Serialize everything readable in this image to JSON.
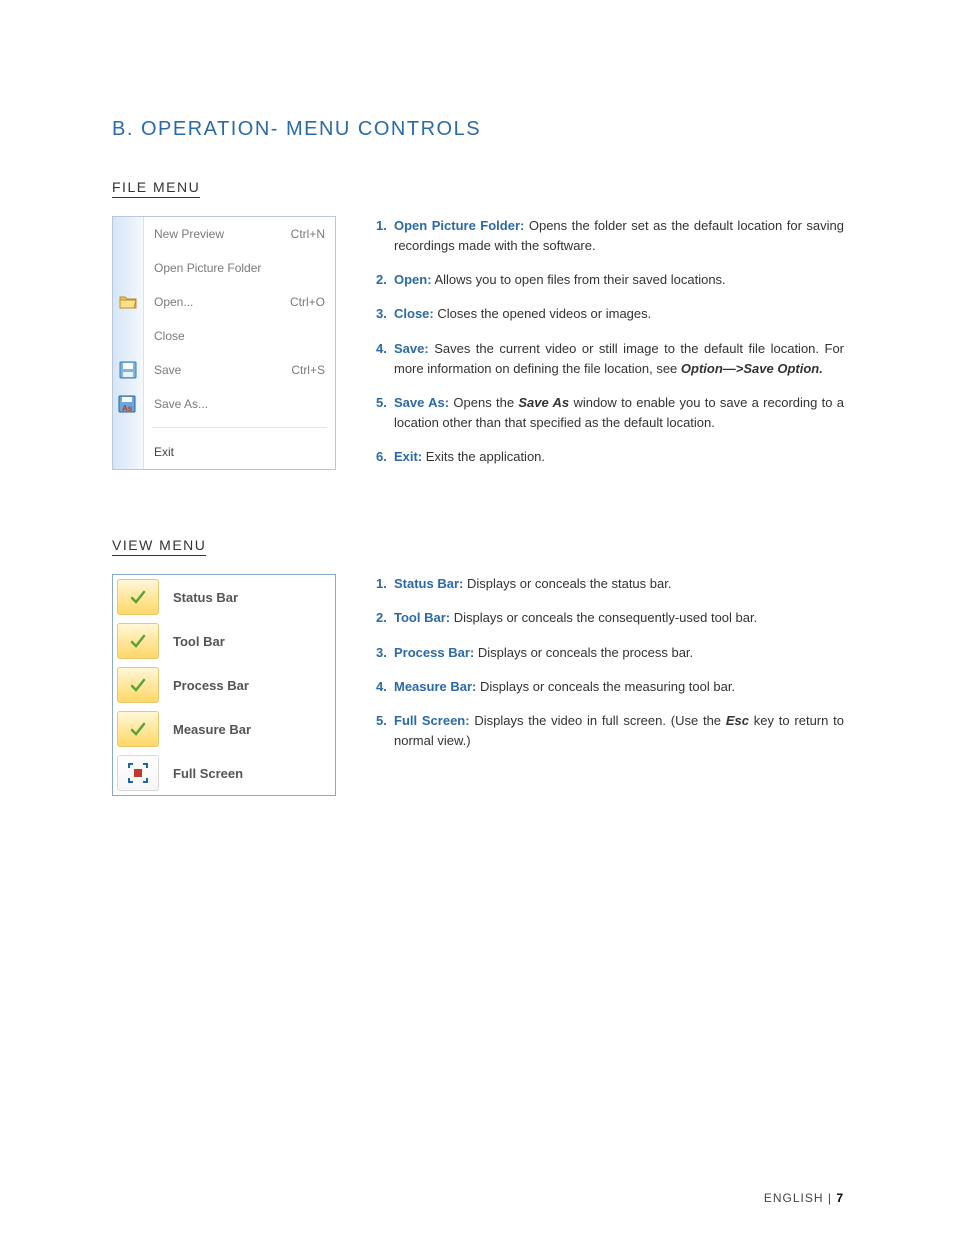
{
  "section_title": "B. OPERATION- MENU CONTROLS",
  "file_menu": {
    "heading": "FILE MENU",
    "items": [
      {
        "label": "New Preview",
        "shortcut": "Ctrl+N",
        "icon": ""
      },
      {
        "label": "Open Picture Folder",
        "shortcut": "",
        "icon": ""
      },
      {
        "label": "Open...",
        "shortcut": "Ctrl+O",
        "icon": "folder"
      },
      {
        "label": "Close",
        "shortcut": "",
        "icon": ""
      },
      {
        "label": "Save",
        "shortcut": "Ctrl+S",
        "icon": "disk"
      },
      {
        "label": "Save As...",
        "shortcut": "",
        "icon": "saveas"
      },
      {
        "sep": true
      },
      {
        "label": "Exit",
        "shortcut": "",
        "icon": ""
      }
    ],
    "descriptions": [
      {
        "n": "1.",
        "term": "Open Picture Folder:",
        "body": " Opens the folder set as the default location for saving recordings made with the software."
      },
      {
        "n": "2.",
        "term": "Open:",
        "body": " Allows you to open files from their saved locations."
      },
      {
        "n": "3.",
        "term": "Close:",
        "body": " Closes the opened videos or images."
      },
      {
        "n": "4.",
        "term": "Save:",
        "body": " Saves the current video or still image to the default file location. For more information on defining the file location, see ",
        "tail_bold": "Option—>Save Option.",
        "tail": ""
      },
      {
        "n": "5.",
        "term": "Save As:",
        "body": " Opens the ",
        "mid_bold": "Save As",
        "body2": " window to enable you to save a recording to a location other than that specified as the default location."
      },
      {
        "n": "6.",
        "term": "Exit:",
        "body": " Exits the application."
      }
    ]
  },
  "view_menu": {
    "heading": "VIEW MENU",
    "items": [
      {
        "label": "Status Bar",
        "icon": "check"
      },
      {
        "label": "Tool Bar",
        "icon": "check"
      },
      {
        "label": "Process Bar",
        "icon": "check"
      },
      {
        "label": "Measure Bar",
        "icon": "check"
      },
      {
        "label": "Full Screen",
        "icon": "fullscreen"
      }
    ],
    "descriptions": [
      {
        "n": "1.",
        "term": "Status Bar:",
        "body": " Displays or conceals the status bar."
      },
      {
        "n": "2.",
        "term": "Tool Bar:",
        "body": " Displays or conceals the consequently-used tool bar."
      },
      {
        "n": "3.",
        "term": "Process Bar:",
        "body": " Displays or conceals the process bar."
      },
      {
        "n": "4.",
        "term": "Measure Bar:",
        "body": " Displays or conceals the measuring tool bar."
      },
      {
        "n": "5.",
        "term": "Full Screen:",
        "body": " Displays the video in full screen. (Use the ",
        "mid_bold": "Esc",
        "body2": " key to return to normal view.)"
      }
    ]
  },
  "footer": {
    "lang": "ENGLISH",
    "sep": " | ",
    "page": "7"
  }
}
